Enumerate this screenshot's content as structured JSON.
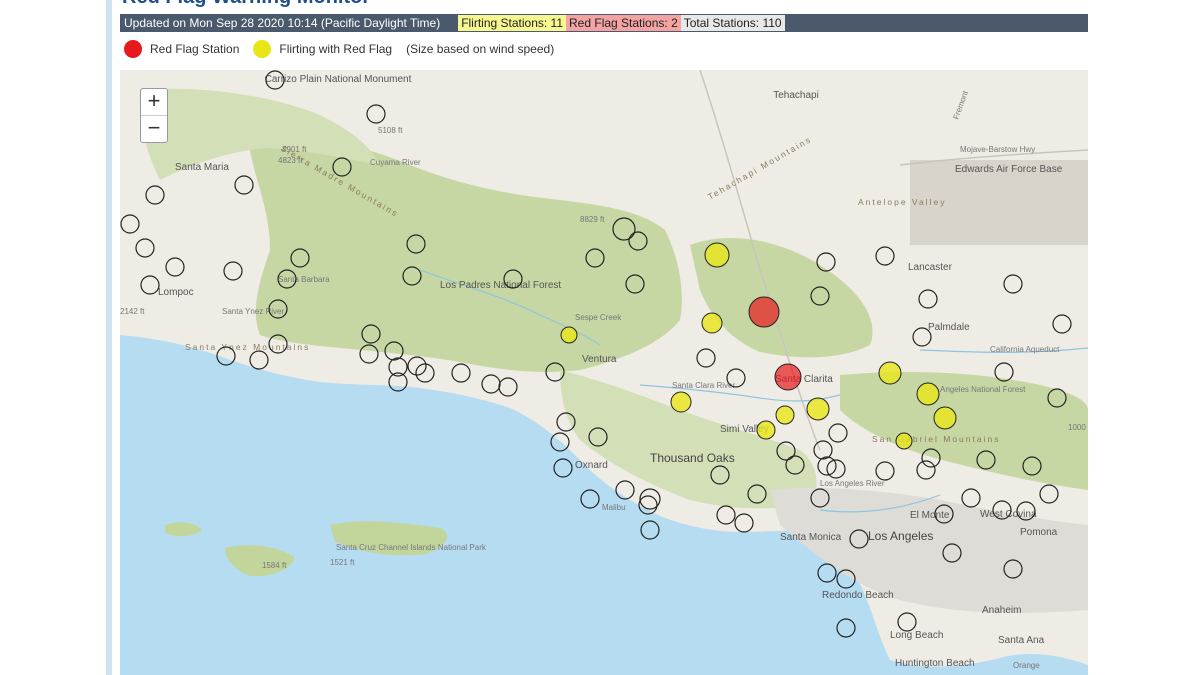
{
  "header": {
    "updated": "Updated on Mon Sep 28 2020 10:14 (Pacific Daylight Time)",
    "flirting_badge": "Flirting Stations: 11",
    "red_flag_badge": "Red Flag Stations: 2",
    "total_badge": "Total Stations: 110"
  },
  "legend": {
    "red_label": "Red Flag Station",
    "yellow_label": "Flirting with Red Flag",
    "note": "(Size based on wind speed)"
  },
  "zoom": {
    "in": "+",
    "out": "−"
  },
  "colors": {
    "red_flag": "#e8191d",
    "flirting": "#e8e617",
    "station_ring": "#222222",
    "ocean": "#b6dcf2",
    "forest": "#c6d7a4"
  },
  "place_labels": [
    "Carrizo Plain National Monument",
    "Tehachapi",
    "Santa Maria",
    "Lompoc",
    "Los Padres National Forest",
    "Ventura",
    "Oxnard",
    "Thousand Oaks",
    "Simi Valley",
    "Santa Clarita",
    "Lancaster",
    "Palmdale",
    "Edwards Air Force Base",
    "Antelope Valley",
    "Mojave-Barstow Hwy",
    "Santa Monica",
    "Los Angeles",
    "El Monte",
    "West Covina",
    "Pomona",
    "Redondo Beach",
    "Long Beach",
    "Anaheim",
    "Santa Ana",
    "Huntington Beach",
    "Orange",
    "Santa Cruz Channel Islands National Park",
    "California Aqueduct",
    "Santa Clara River",
    "Los Angeles River",
    "Santa Ynez River",
    "Cuyama River",
    "Sespe Creek",
    "Angeles National Forest",
    "Tehachapi Mountains",
    "Sierra Madre Mountains",
    "San Gabriel Mountains",
    "Santa Ynez Mountains",
    "Santa Barbara",
    "Malibu",
    "Fremont"
  ],
  "elevations": [
    "5108 ft",
    "4901 ft",
    "4823 ft",
    "8829 ft",
    "2142 ft",
    "1584 ft",
    "1521 ft",
    "1000"
  ],
  "stations": {
    "red_flag": [
      {
        "wind": "high"
      },
      {
        "wind": "medium"
      }
    ],
    "flirting_count": 11,
    "normal_count": 97
  }
}
